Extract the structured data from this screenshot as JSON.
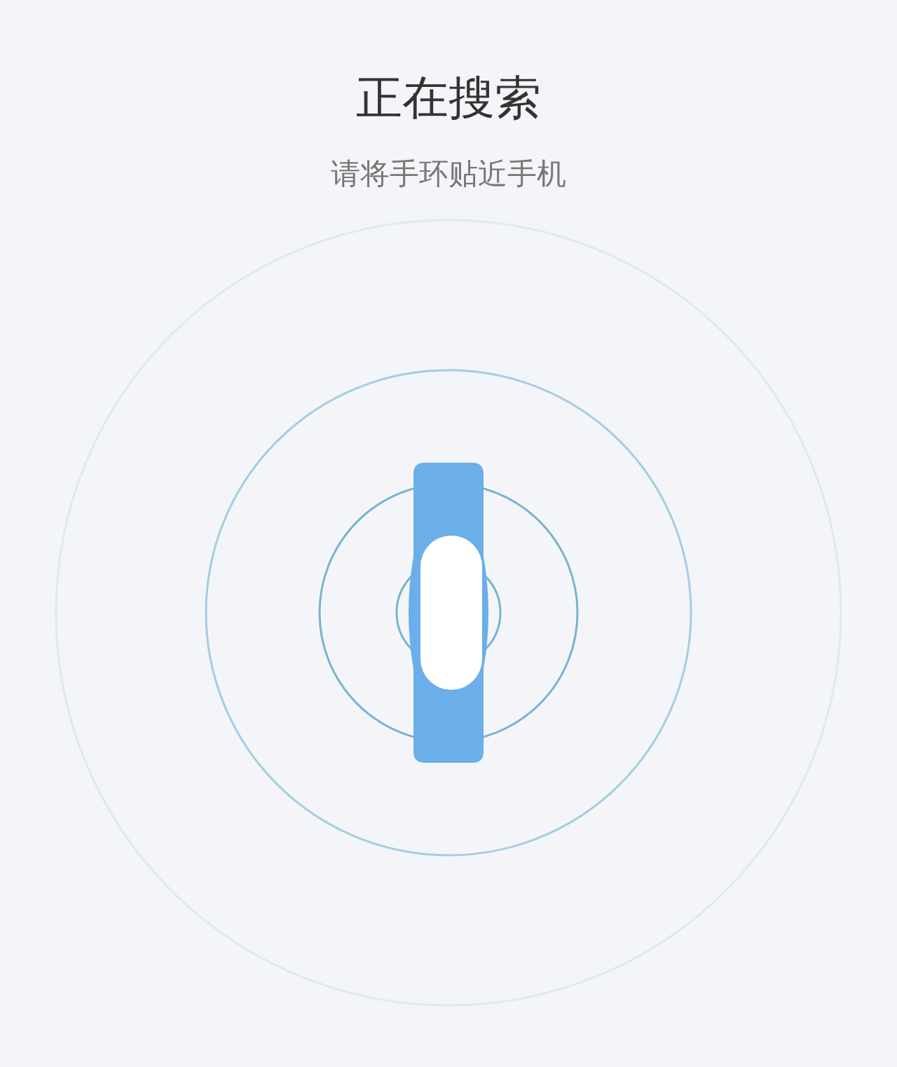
{
  "title": "正在搜索",
  "subtitle": "请将手环贴近手机"
}
